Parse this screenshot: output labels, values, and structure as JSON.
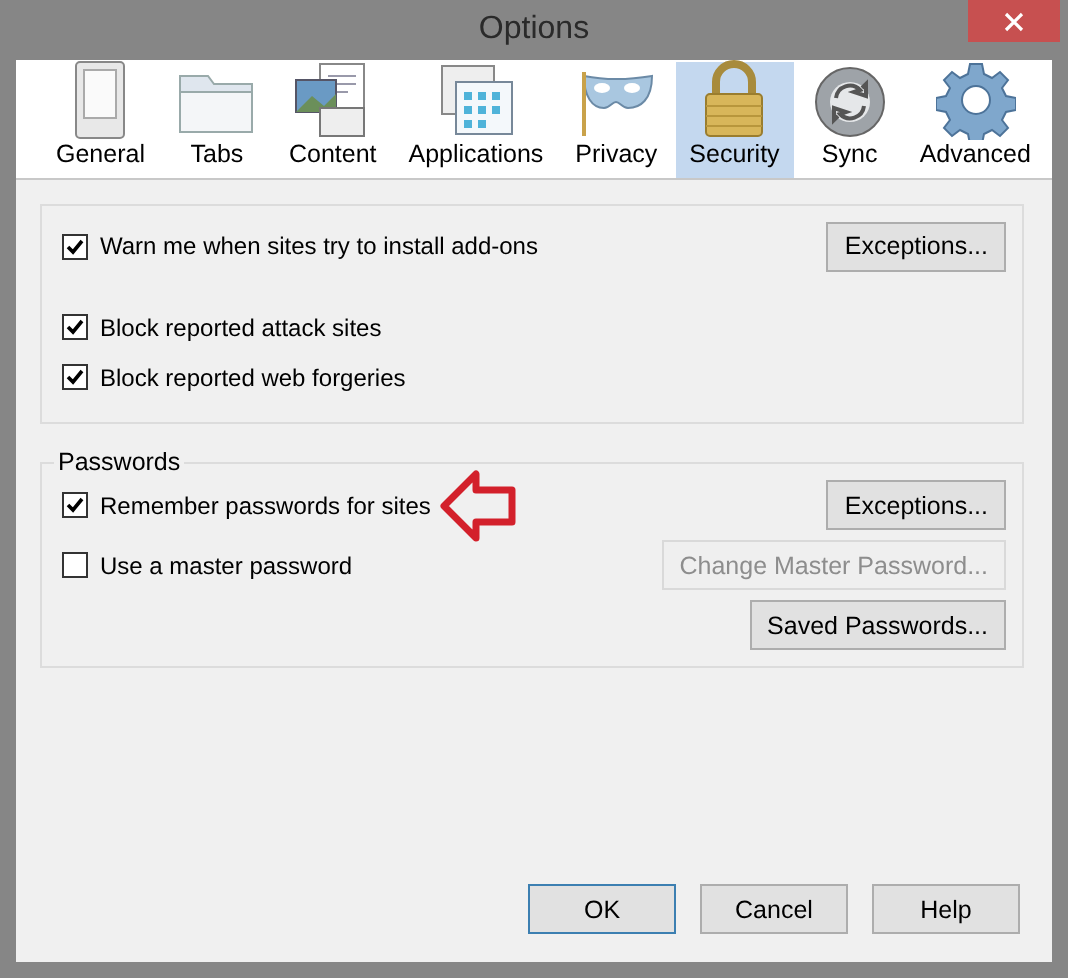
{
  "window": {
    "title": "Options"
  },
  "tabs": [
    {
      "label": "General",
      "selected": false
    },
    {
      "label": "Tabs",
      "selected": false
    },
    {
      "label": "Content",
      "selected": false
    },
    {
      "label": "Applications",
      "selected": false
    },
    {
      "label": "Privacy",
      "selected": false
    },
    {
      "label": "Security",
      "selected": true
    },
    {
      "label": "Sync",
      "selected": false
    },
    {
      "label": "Advanced",
      "selected": false
    }
  ],
  "general_group": {
    "rows": [
      {
        "label": "Warn me when sites try to install add-ons",
        "checked": true,
        "button": {
          "label": "Exceptions...",
          "disabled": false
        }
      },
      {
        "label": "Block reported attack sites",
        "checked": true
      },
      {
        "label": "Block reported web forgeries",
        "checked": true
      }
    ]
  },
  "passwords_group": {
    "title": "Passwords",
    "rows": [
      {
        "label": "Remember passwords for sites",
        "checked": true,
        "button": {
          "label": "Exceptions...",
          "disabled": false
        }
      },
      {
        "label": "Use a master password",
        "checked": false,
        "button": {
          "label": "Change Master Password...",
          "disabled": true
        }
      }
    ],
    "saved_button": {
      "label": "Saved Passwords...",
      "disabled": false
    }
  },
  "footer_buttons": [
    {
      "label": "OK",
      "default": true
    },
    {
      "label": "Cancel",
      "default": false
    },
    {
      "label": "Help",
      "default": false
    }
  ]
}
